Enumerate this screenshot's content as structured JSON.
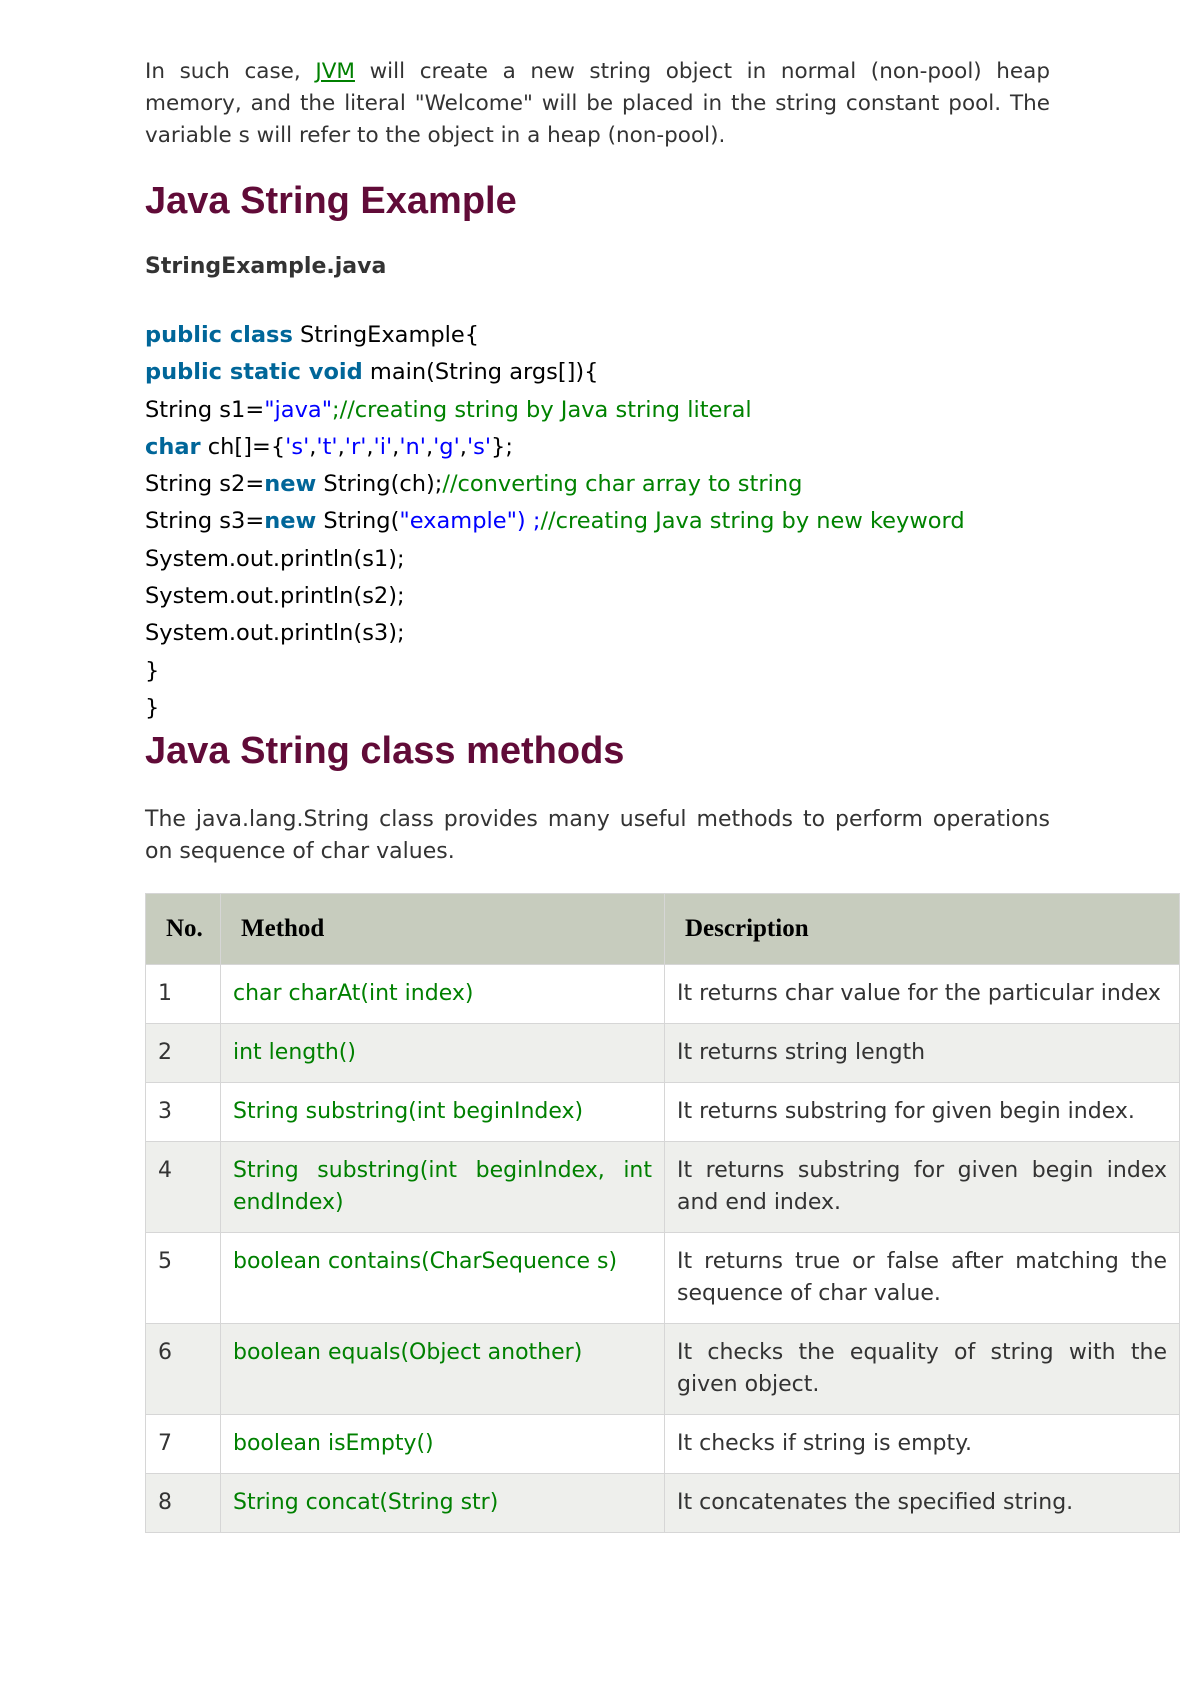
{
  "intro": {
    "text_before_link": "In such case, ",
    "link_text": "JVM",
    "text_after_link": " will create a new string object in normal (non-pool) heap memory, and the literal \"Welcome\" will be placed in the string constant pool. The variable s will refer to the object in a heap (non-pool)."
  },
  "example_section": {
    "heading": "Java String Example",
    "filename": "StringExample.java",
    "code": {
      "l1_kw": "public class",
      "l1_rest": " StringExample{",
      "l2_kw": "public static void",
      "l2_rest": " main(String args[]){",
      "l3_a": "String s1=",
      "l3_str": "\"java\"",
      "l3_com": ";//creating string by Java string literal",
      "l4_kw": "char",
      "l4_a": " ch[]={",
      "l4_c1": "'s'",
      "l4_c2": "'t'",
      "l4_c3": "'r'",
      "l4_c4": "'i'",
      "l4_c5": "'n'",
      "l4_c6": "'g'",
      "l4_c7": "'s'",
      "l4_end": "};",
      "l5_a": "String s2=",
      "l5_kw": "new",
      "l5_b": " String(ch);",
      "l5_com": "//converting char array to string",
      "l6_a": "String s3=",
      "l6_kw": "new",
      "l6_b": " String(",
      "l6_str": "\"example\") ;",
      "l6_com": "//creating Java string by new keyword",
      "l7": "System.out.println(s1);",
      "l8": "System.out.println(s2);",
      "l9": "System.out.println(s3);",
      "l10": "}",
      "l11": "}"
    }
  },
  "methods_section": {
    "heading": "Java String class methods",
    "description": "The java.lang.String class provides many useful methods to perform operations on sequence of char values.",
    "table": {
      "headers": {
        "no": "No.",
        "method": "Method",
        "description": "Description"
      },
      "rows": [
        {
          "no": "1",
          "method": "char charAt(int index)",
          "description": "It returns char value for the particular index"
        },
        {
          "no": "2",
          "method": "int length()",
          "description": "It returns string length"
        },
        {
          "no": "3",
          "method": "String substring(int beginIndex)",
          "description": "It returns substring for given begin index."
        },
        {
          "no": "4",
          "method": "String substring(int beginIndex, int endIndex)",
          "description": "It returns substring for given begin index and end index."
        },
        {
          "no": "5",
          "method": "boolean contains(CharSequence s)",
          "description": "It returns true or false after matching the sequence of char value."
        },
        {
          "no": "6",
          "method": "boolean equals(Object another)",
          "description": "It checks the equality of string with the given object."
        },
        {
          "no": "7",
          "method": "boolean isEmpty()",
          "description": "It checks if string is empty."
        },
        {
          "no": "8",
          "method": "String concat(String str)",
          "description": "It concatenates the specified string."
        }
      ]
    }
  }
}
